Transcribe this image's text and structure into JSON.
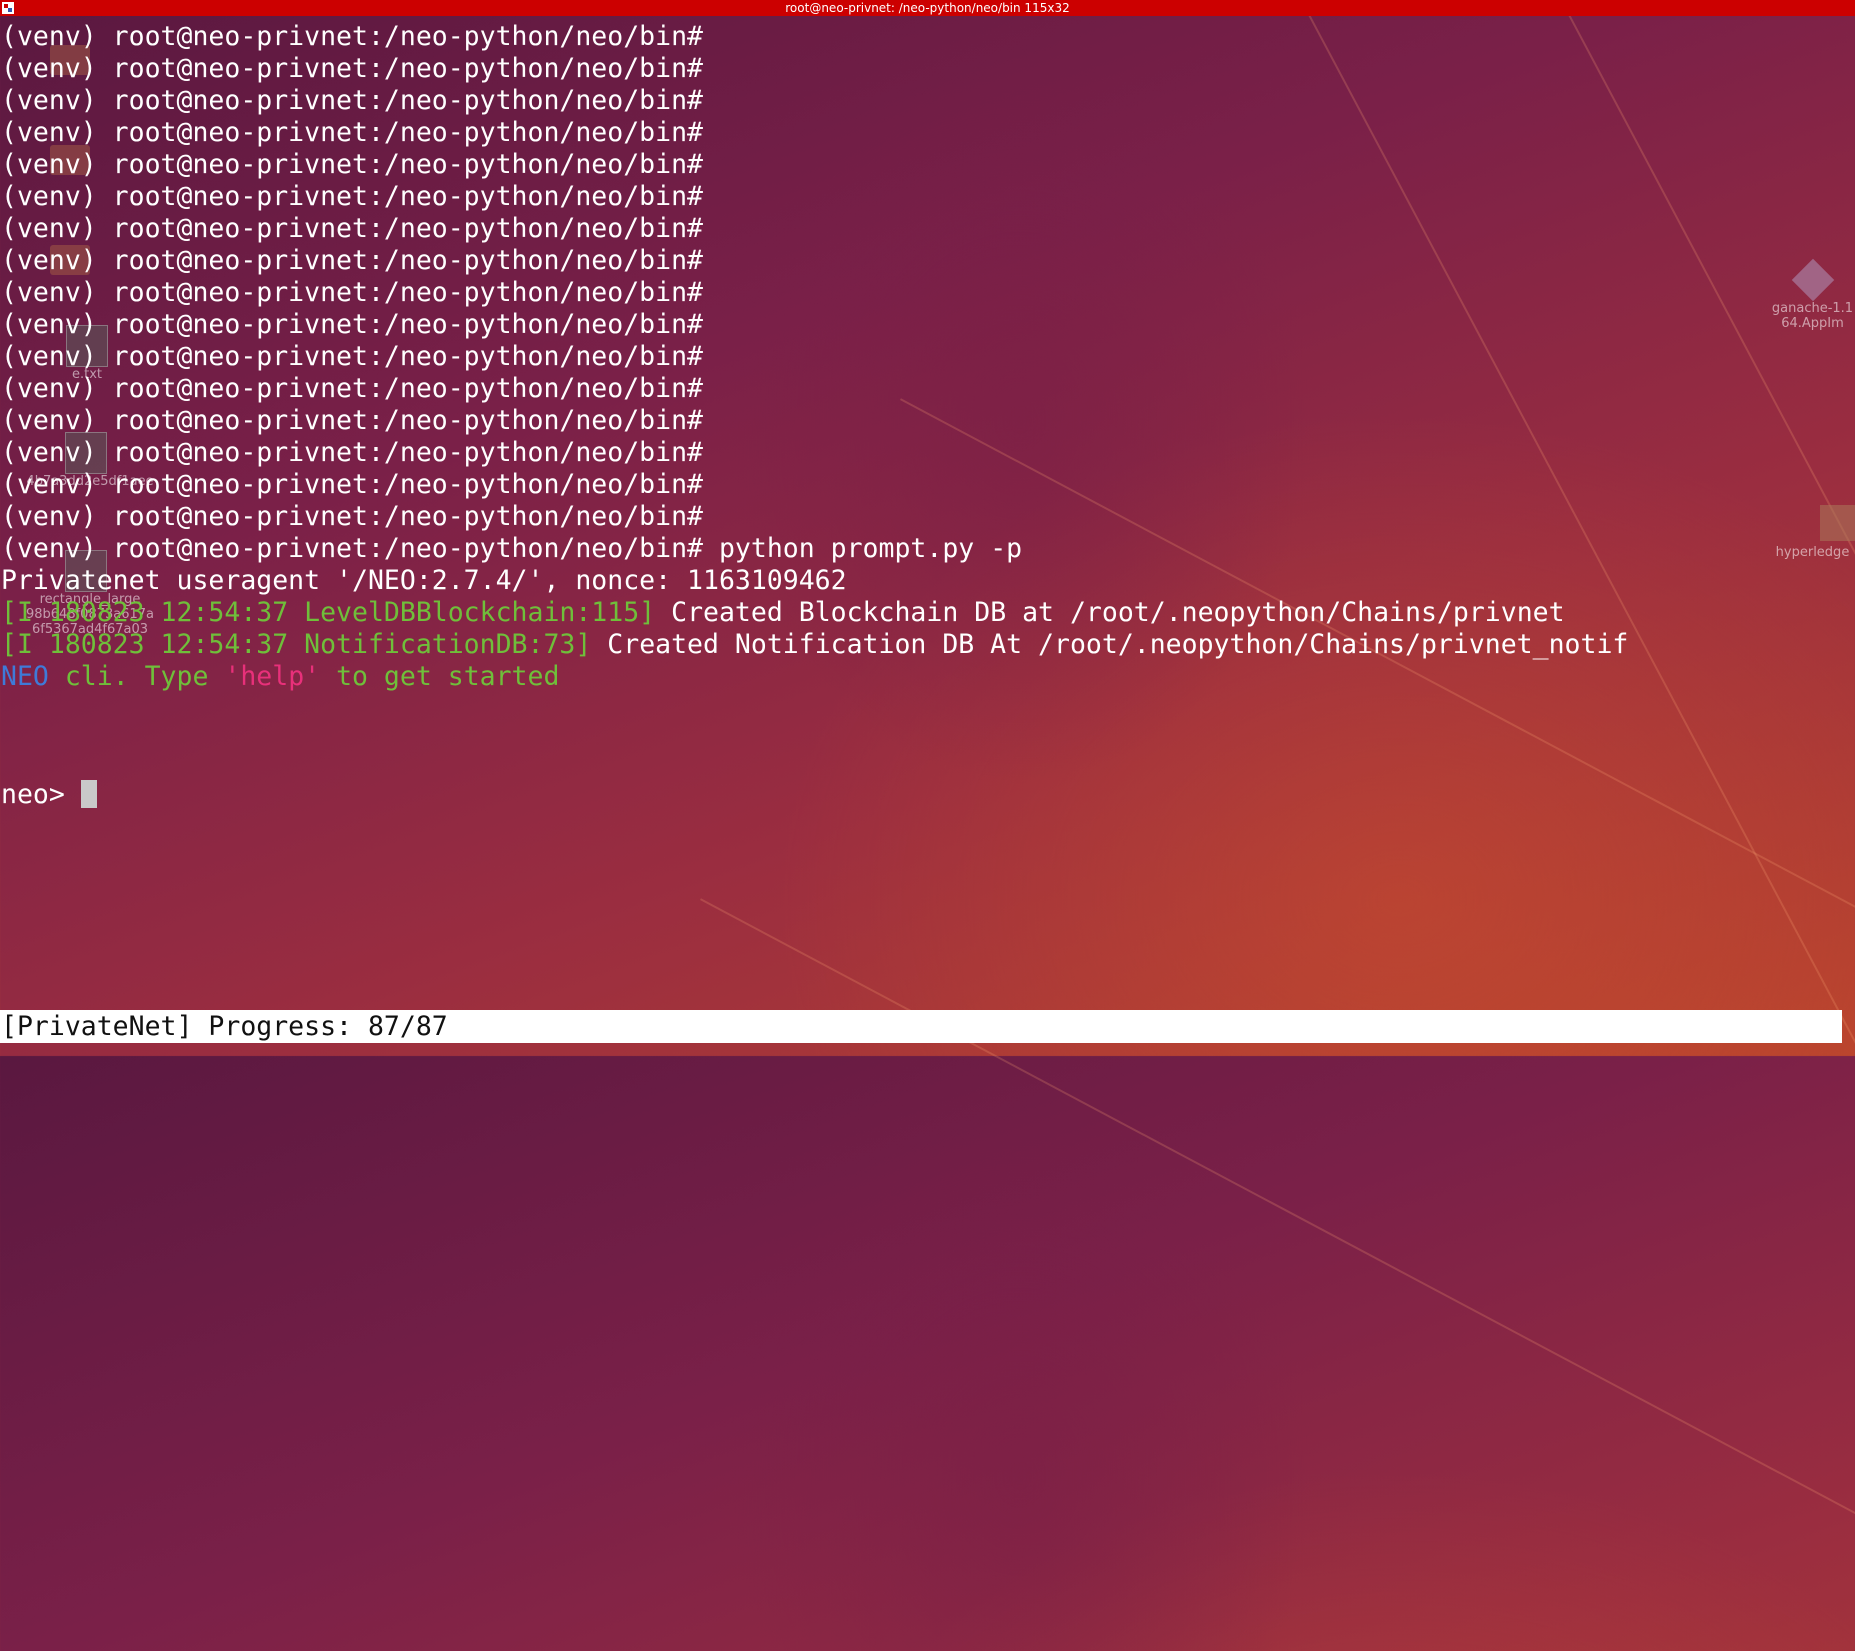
{
  "window": {
    "title": "root@neo-privnet: /neo-python/neo/bin 115x32"
  },
  "terminal": {
    "prompt": "(venv) root@neo-privnet:/neo-python/neo/bin#",
    "command": "python prompt.py -p",
    "useragent_line": "Privatenet useragent '/NEO:2.7.4/', nonce: 1163109462",
    "log1_prefix": "[I 180823 12:54:37 LevelDBBlockchain:115]",
    "log1_message": "Created Blockchain DB at /root/.neopython/Chains/privnet",
    "log2_prefix": "[I 180823 12:54:37 NotificationDB:73]",
    "log2_message": "Created Notification DB At /root/.neopython/Chains/privnet_notif",
    "welcome_neo": "NEO",
    "welcome_cli": " cli. Type ",
    "welcome_help": "'help'",
    "welcome_rest": " to get started",
    "neo_prompt": "neo>"
  },
  "statusbar": {
    "text": "[PrivateNet] Progress: 87/87"
  },
  "desktop": {
    "icons": [
      {
        "label": "ganache-1.1\n64.AppIm"
      },
      {
        "label": "hyperledge"
      },
      {
        "label": "rectangle_large"
      },
      {
        "label": "4b7a3dd2e5df1aee"
      },
      {
        "label": "98b648f0873a617a"
      },
      {
        "label": "6f5367ad4f67a03"
      },
      {
        "label": "e.txt"
      }
    ]
  },
  "colors": {
    "titlebar": "#cc0000",
    "log_green": "#6fbf3a",
    "neo_blue": "#3f7ad8",
    "help_pink": "#e8307a"
  }
}
